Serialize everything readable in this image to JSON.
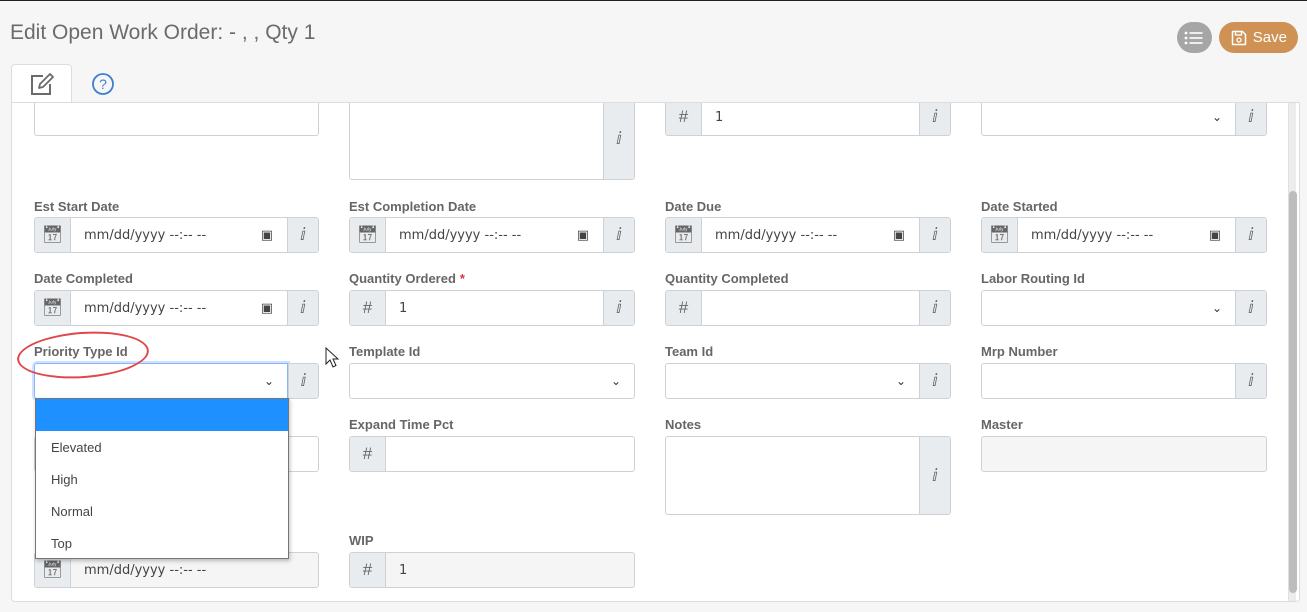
{
  "header": {
    "title": "Edit Open Work Order: - , , Qty 1",
    "save_label": "Save",
    "list_button": "list-icon",
    "save_icon": "floppy-disk-icon"
  },
  "tabs": [
    {
      "icon": "edit-icon",
      "active": true
    },
    {
      "icon": "help-icon",
      "active": false
    }
  ],
  "colors": {
    "save_button": "#cf9254",
    "list_button": "#a6a6a6",
    "dropdown_selected": "#1e90ff",
    "annotation_circle": "#e0474c",
    "required_star": "#e0314b"
  },
  "form": {
    "top_row": {
      "number_value": "1"
    },
    "est_start_date": {
      "label": "Est Start Date",
      "placeholder": "mm/dd/yyyy --:-- --"
    },
    "est_completion_date": {
      "label": "Est Completion Date",
      "placeholder": "mm/dd/yyyy --:-- --"
    },
    "date_due": {
      "label": "Date Due",
      "placeholder": "mm/dd/yyyy --:-- --"
    },
    "date_started": {
      "label": "Date Started",
      "placeholder": "mm/dd/yyyy --:-- --"
    },
    "date_completed": {
      "label": "Date Completed",
      "placeholder": "mm/dd/yyyy --:-- --"
    },
    "quantity_ordered": {
      "label": "Quantity Ordered",
      "value": "1",
      "required": "*"
    },
    "quantity_completed": {
      "label": "Quantity Completed",
      "value": ""
    },
    "labor_routing_id": {
      "label": "Labor Routing Id",
      "value": ""
    },
    "priority_type_id": {
      "label": "Priority Type Id",
      "value": "",
      "options": [
        "",
        "Elevated",
        "High",
        "Normal",
        "Top"
      ]
    },
    "template_id": {
      "label": "Template Id",
      "value": ""
    },
    "team_id": {
      "label": "Team Id",
      "value": ""
    },
    "mrp_number": {
      "label": "Mrp Number",
      "value": ""
    },
    "expand_time_pct": {
      "label": "Expand Time Pct",
      "value": ""
    },
    "notes": {
      "label": "Notes",
      "value": ""
    },
    "master": {
      "label": "Master",
      "value": ""
    },
    "hidden_date": {
      "placeholder": "mm/dd/yyyy --:-- --"
    },
    "wip": {
      "label": "WIP",
      "value": "1"
    }
  }
}
